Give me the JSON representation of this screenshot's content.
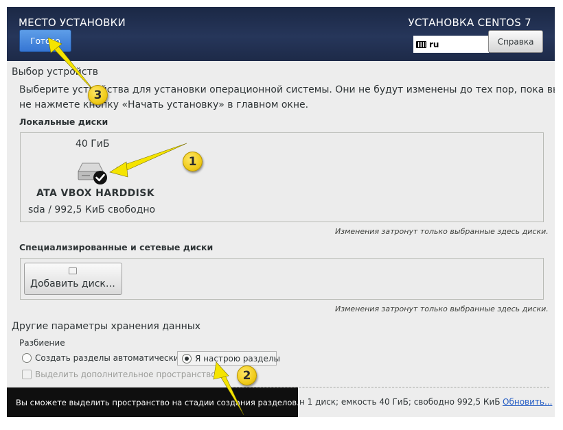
{
  "header": {
    "title": "МЕСТО УСТАНОВКИ",
    "product": "УСТАНОВКА CENTOS 7",
    "done_label": "Готово",
    "keyboard_layout": "ru",
    "help_label": "Справка"
  },
  "devices": {
    "section_title": "Выбор устройств",
    "description_line1": "Выберите устройства для установки операционной системы. Они не будут изменены до тех пор, пока вы",
    "description_line2": "не нажмете кнопку «Начать установку» в главном окне.",
    "local_label": "Локальные диски",
    "disk": {
      "size": "40 ГиБ",
      "name": "ATA VBOX HARDDISK",
      "info": "sda  /  992,5 КиБ свободно",
      "selected": true
    },
    "local_note": "Изменения затронут только выбранные здесь диски.",
    "special_label": "Специализированные и сетевые диски",
    "add_disk_label": "Добавить диск…",
    "special_note": "Изменения затронут только выбранные здесь диски."
  },
  "storage": {
    "section_title": "Другие параметры хранения данных",
    "partition_label": "Разбиение",
    "auto_label": "Создать разделы автоматически",
    "manual_label": "Я настрою разделы",
    "selected_option": "manual",
    "extra_space_label": "Выделить дополнительное пространство"
  },
  "footer": {
    "toast": "Вы сможете выделить пространство на стадии создания разделов.",
    "summary": "н 1 диск; емкость 40 ГиБ; свободно 992,5 КиБ",
    "refresh_label": "Обновить..."
  },
  "annotations": {
    "badges": [
      "1",
      "2",
      "3"
    ],
    "color": "#f5e400"
  },
  "colors": {
    "header_bg": "#26365a",
    "done_button": "#3f82dd",
    "link": "#2960c5",
    "toast_bg": "#0f0f0f"
  }
}
